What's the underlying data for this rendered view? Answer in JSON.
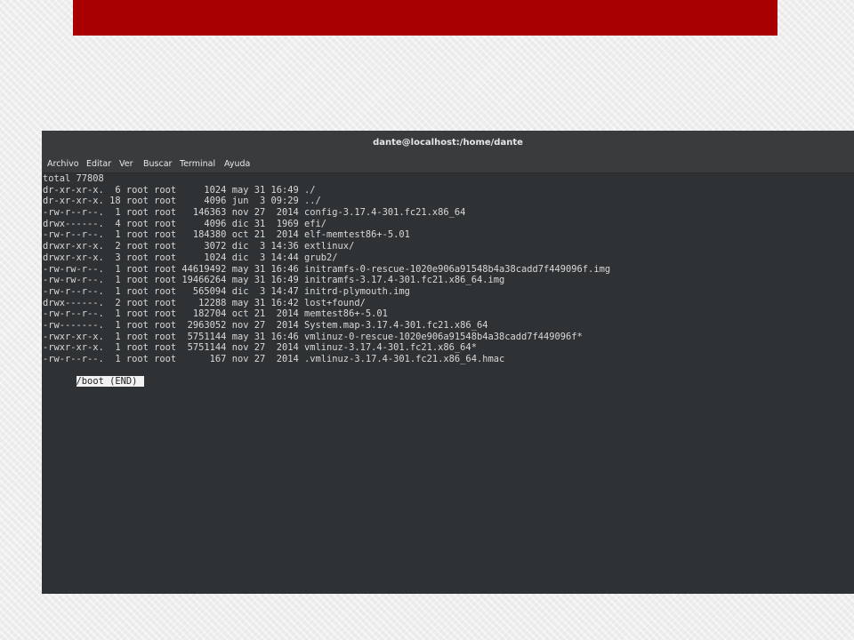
{
  "window": {
    "title": "dante@localhost:/home/dante"
  },
  "menu": [
    "Archivo",
    "Editar",
    "Ver",
    "Buscar",
    "Terminal",
    "Ayuda"
  ],
  "terminal": {
    "lines": [
      "total 77808",
      "dr-xr-xr-x.  6 root root     1024 may 31 16:49 ./",
      "dr-xr-xr-x. 18 root root     4096 jun  3 09:29 ../",
      "-rw-r--r--.  1 root root   146363 nov 27  2014 config-3.17.4-301.fc21.x86_64",
      "drwx------.  4 root root     4096 dic 31  1969 efi/",
      "-rw-r--r--.  1 root root   184380 oct 21  2014 elf-memtest86+-5.01",
      "drwxr-xr-x.  2 root root     3072 dic  3 14:36 extlinux/",
      "drwxr-xr-x.  3 root root     1024 dic  3 14:44 grub2/",
      "-rw-rw-r--.  1 root root 44619492 may 31 16:46 initramfs-0-rescue-1020e906a91548b4a38cadd7f449096f.img",
      "-rw-rw-r--.  1 root root 19466264 may 31 16:49 initramfs-3.17.4-301.fc21.x86_64.img",
      "-rw-r--r--.  1 root root   565094 dic  3 14:47 initrd-plymouth.img",
      "drwx------.  2 root root    12288 may 31 16:42 lost+found/",
      "-rw-r--r--.  1 root root   182704 oct 21  2014 memtest86+-5.01",
      "-rw-------.  1 root root  2963052 nov 27  2014 System.map-3.17.4-301.fc21.x86_64",
      "-rwxr-xr-x.  1 root root  5751144 may 31 16:46 vmlinuz-0-rescue-1020e906a91548b4a38cadd7f449096f*",
      "-rwxr-xr-x.  1 root root  5751144 nov 27  2014 vmlinuz-3.17.4-301.fc21.x86_64*",
      "-rw-r--r--.  1 root root      167 nov 27  2014 .vmlinuz-3.17.4-301.fc21.x86_64.hmac"
    ],
    "prompt": "/boot (END)"
  },
  "colors": {
    "banner": "#a80000",
    "terminal_bg": "#2f3234",
    "terminal_fg": "#d8d8d8"
  }
}
